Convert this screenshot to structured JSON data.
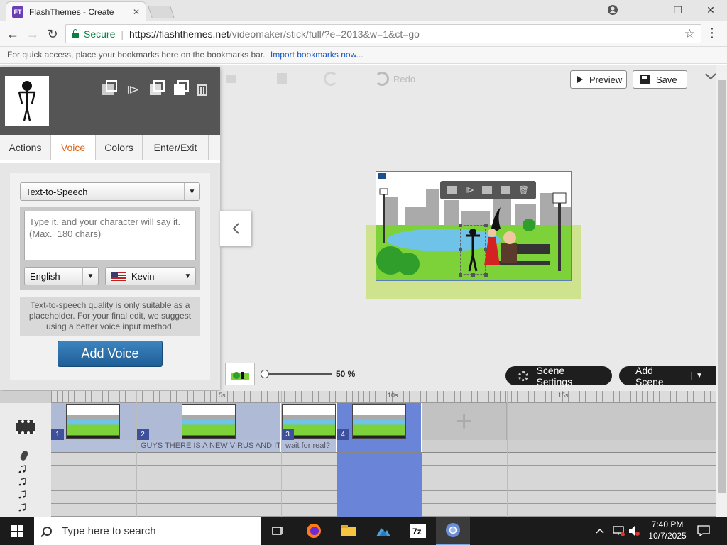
{
  "browser": {
    "tab_title": "FlashThemes - Create",
    "tab_favicon": "FT",
    "secure_label": "Secure",
    "url_host": "https://flashthemes.net",
    "url_path": "/videomaker/stick/full/?e=2013&w=1&ct=go",
    "bookmarks_text": "For quick access, place your bookmarks here on the bookmarks bar.",
    "bookmarks_link": "Import bookmarks now..."
  },
  "toolbar": {
    "redo_label": "Redo",
    "preview_label": "Preview",
    "save_label": "Save"
  },
  "panel": {
    "tabs": [
      {
        "label": "Actions"
      },
      {
        "label": "Voice"
      },
      {
        "label": "Colors"
      },
      {
        "label": "Enter/Exit"
      }
    ],
    "active_tab": "Voice",
    "voice_method": "Text-to-Speech",
    "tts_placeholder": "Type it, and your character will say it.  (Max.  180 chars)",
    "language": "English",
    "voice_name": "Kevin",
    "note": "Text-to-speech quality is only suitable as a placeholder. For your final edit, we suggest using a better voice input method.",
    "add_voice_label": "Add Voice"
  },
  "stage_controls": {
    "zoom_value": "50 %",
    "scene_settings_label": "Scene Settings",
    "add_scene_label": "Add Scene"
  },
  "timeline": {
    "ruler_labels": [
      "5s",
      "10s",
      "15s"
    ],
    "scenes": [
      {
        "number": "1",
        "selected": false
      },
      {
        "number": "2",
        "selected": false
      },
      {
        "number": "3",
        "selected": false
      },
      {
        "number": "4",
        "selected": true
      }
    ],
    "voice_clips": [
      {
        "text": ""
      },
      {
        "text": "GUYS THERE IS A NEW VIRUS AND IT..."
      },
      {
        "text": "wait for real?"
      },
      {
        "text": ""
      }
    ]
  },
  "taskbar": {
    "search_placeholder": "Type here to search",
    "time": "7:40 PM",
    "date": "10/7/2025"
  },
  "colors": {
    "accent_tab": "#d9641a",
    "add_voice_button": "#1e5e96",
    "selected_scene": "#6a84d8",
    "secure_green": "#0b8043"
  }
}
